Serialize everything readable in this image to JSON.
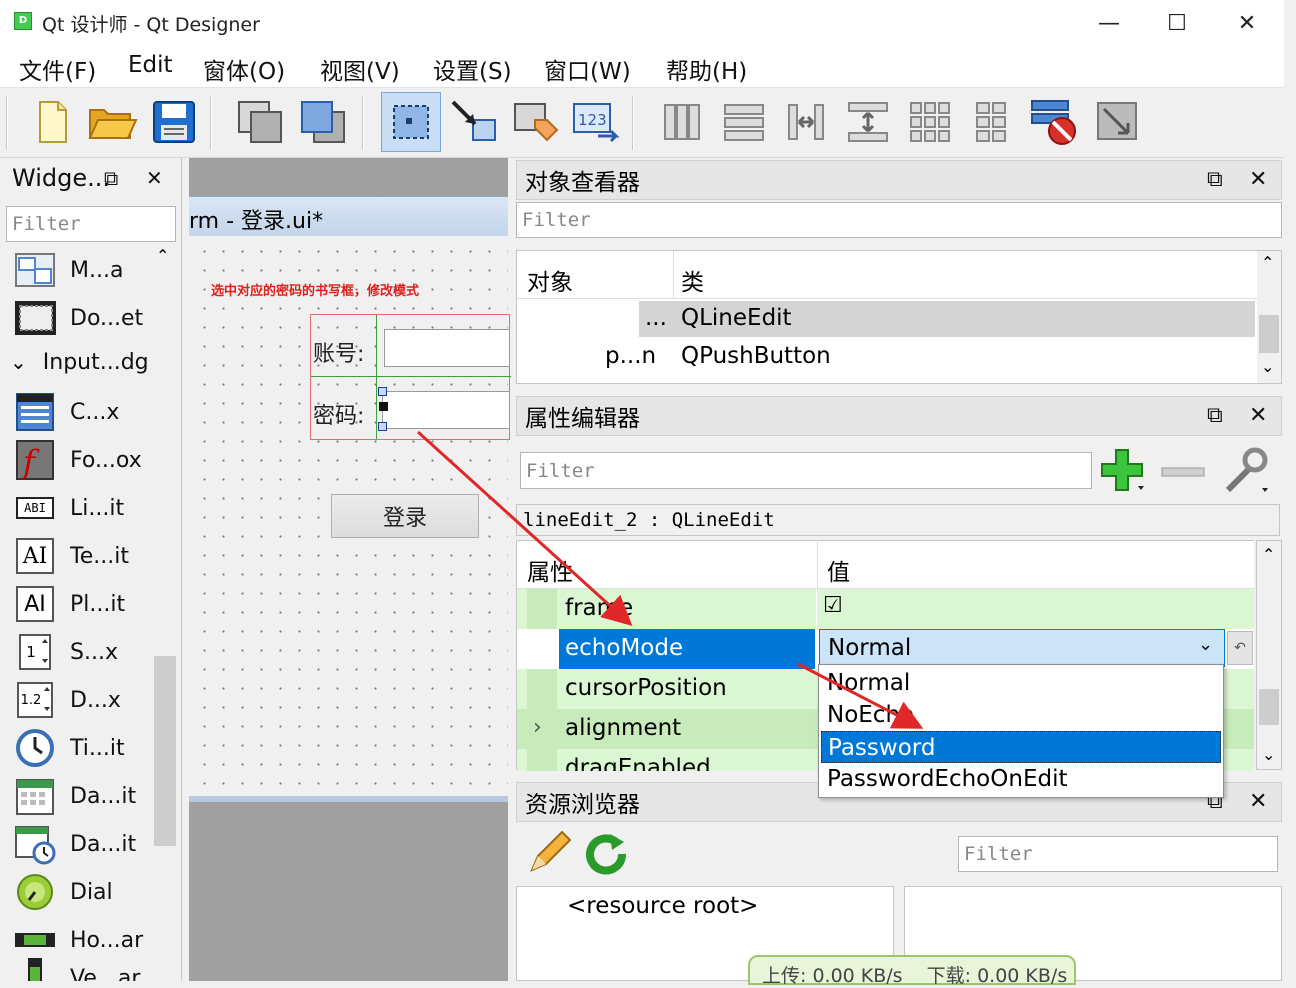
{
  "window": {
    "app_icon_text": "D",
    "title": "Qt 设计师 - Qt Designer",
    "min": "—",
    "max": "☐",
    "close": "✕"
  },
  "menu": [
    "文件(F)",
    "Edit",
    "窗体(O)",
    "视图(V)",
    "设置(S)",
    "窗口(W)",
    "帮助(H)"
  ],
  "toolbar_icons": [
    "new-file-icon",
    "open-folder-icon",
    "save-icon",
    "send-to-back-icon",
    "bring-to-front-icon",
    "edit-widgets-icon",
    "edit-signals-slots-icon",
    "edit-buddies-icon",
    "edit-tab-order-icon",
    "layout-horizontal-icon",
    "layout-vertical-icon",
    "layout-horizontal-splitter-icon",
    "layout-vertical-splitter-icon",
    "layout-grid-icon",
    "layout-form-icon",
    "break-layout-icon",
    "adjust-size-icon"
  ],
  "widget_box": {
    "title": "Widge...",
    "float": "⧉",
    "close": "✕",
    "filter_placeholder": "Filter",
    "items_top": [
      {
        "label": "M...a",
        "icon": "mdi-area-icon"
      },
      {
        "label": "Do...et",
        "icon": "dock-widget-icon"
      }
    ],
    "section": "Input...dg",
    "section_arrow": "⌄",
    "items": [
      {
        "label": "C...x",
        "icon": "combo-box-icon"
      },
      {
        "label": "Fo...ox",
        "icon": "font-combo-box-icon"
      },
      {
        "label": "Li...it",
        "icon": "line-edit-icon"
      },
      {
        "label": "Te...it",
        "icon": "text-edit-icon"
      },
      {
        "label": "Pl...it",
        "icon": "plain-text-edit-icon"
      },
      {
        "label": "S...x",
        "icon": "spin-box-icon"
      },
      {
        "label": "D...x",
        "icon": "double-spin-box-icon"
      },
      {
        "label": "Ti...it",
        "icon": "time-edit-icon"
      },
      {
        "label": "Da...it",
        "icon": "date-edit-icon"
      },
      {
        "label": "Da...it",
        "icon": "date-time-edit-icon"
      },
      {
        "label": "Dial",
        "icon": "dial-icon"
      },
      {
        "label": "Ho...ar",
        "icon": "horizontal-scrollbar-icon"
      },
      {
        "label": "Ve...ar",
        "icon": "vertical-scrollbar-icon"
      }
    ],
    "icon_text": {
      "line_edit": "ABI",
      "text_edit": "AI",
      "plain_text_edit": "AI",
      "spin": "1",
      "double_spin": "1.2"
    }
  },
  "form": {
    "title": "rm - 登录.ui*",
    "hint": "选中对应的密码的书写框，修改模式",
    "account_label": "账号:",
    "password_label": "密码:",
    "login_button": "登录"
  },
  "object_inspector": {
    "title": "对象查看器",
    "filter_placeholder": "Filter",
    "col_object": "对象",
    "col_class": "类",
    "rows": [
      {
        "object": "...",
        "class": "QLineEdit"
      },
      {
        "object": "p...n",
        "class": "QPushButton"
      }
    ]
  },
  "property_editor": {
    "title": "属性编辑器",
    "filter_placeholder": "Filter",
    "add": "+",
    "remove": "—",
    "object_line": "lineEdit_2 : QLineEdit",
    "col_property": "属性",
    "col_value": "值",
    "rows": [
      {
        "name": "frame",
        "value": "☑"
      },
      {
        "name": "echoMode",
        "value": "Normal"
      },
      {
        "name": "cursorPosition",
        "value": ""
      },
      {
        "name": "alignment",
        "value": ""
      },
      {
        "name": "dragEnabled",
        "value": ""
      }
    ],
    "expand_arrow": "›",
    "combo_arrow": "⌄",
    "reset": "↶",
    "options": [
      "Normal",
      "NoEcho",
      "Password",
      "PasswordEchoOnEdit"
    ],
    "selected_option": "Password"
  },
  "resource_browser": {
    "title": "资源浏览器",
    "filter_placeholder": "Filter",
    "root": "<resource root>"
  },
  "network": {
    "up": "上传: 0.00 KB/s",
    "down": "下载: 0.00 KB/s"
  },
  "colors": {
    "selection": "#0078d7",
    "prop_green": "#d9f5d0",
    "prop_green_dark": "#c7ebbb",
    "arrow_red": "#e02828"
  }
}
